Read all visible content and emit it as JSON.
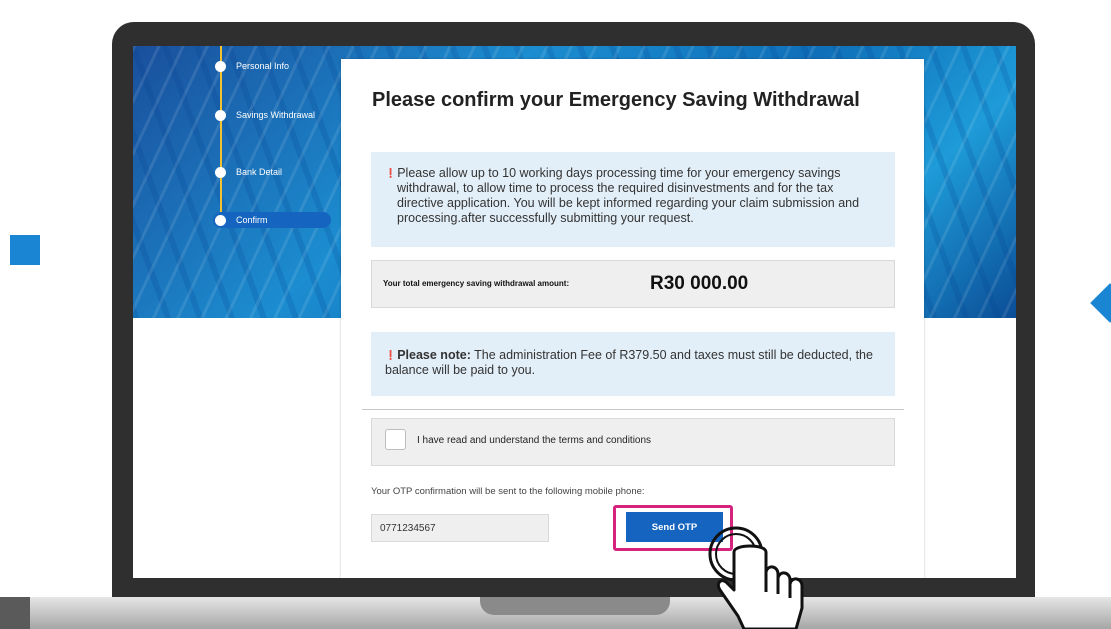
{
  "steps": [
    {
      "label": "Personal Info"
    },
    {
      "label": "Savings Withdrawal"
    },
    {
      "label": "Bank Detail"
    },
    {
      "label": "Confirm",
      "active": true
    }
  ],
  "card": {
    "title": "Please confirm your Emergency Saving Withdrawal",
    "info_icon": "info-icon",
    "processing_notice": "Please allow up to 10 working days processing time for your emergency savings withdrawal, to allow time to process the required disinvestments and for the tax directive application. You will be kept informed regarding your claim submission and processing.after successfully submitting your request.",
    "amount_label": "Your total emergency saving withdrawal amount:",
    "amount_value": "R30 000.00",
    "note_bold": "Please note:",
    "note_text": "The administration Fee of R379.50 and taxes must still be deducted, the balance will be paid to you.",
    "terms_label": "I have read and understand the terms and conditions",
    "otp_note": "Your OTP confirmation will be sent to the following mobile phone:",
    "phone_value": "0771234567",
    "send_otp_label": "Send OTP"
  },
  "colors": {
    "accent": "#1565c0",
    "highlight": "#d6237d",
    "step_line": "#f2c233",
    "info_bg": "#e3eff8"
  }
}
